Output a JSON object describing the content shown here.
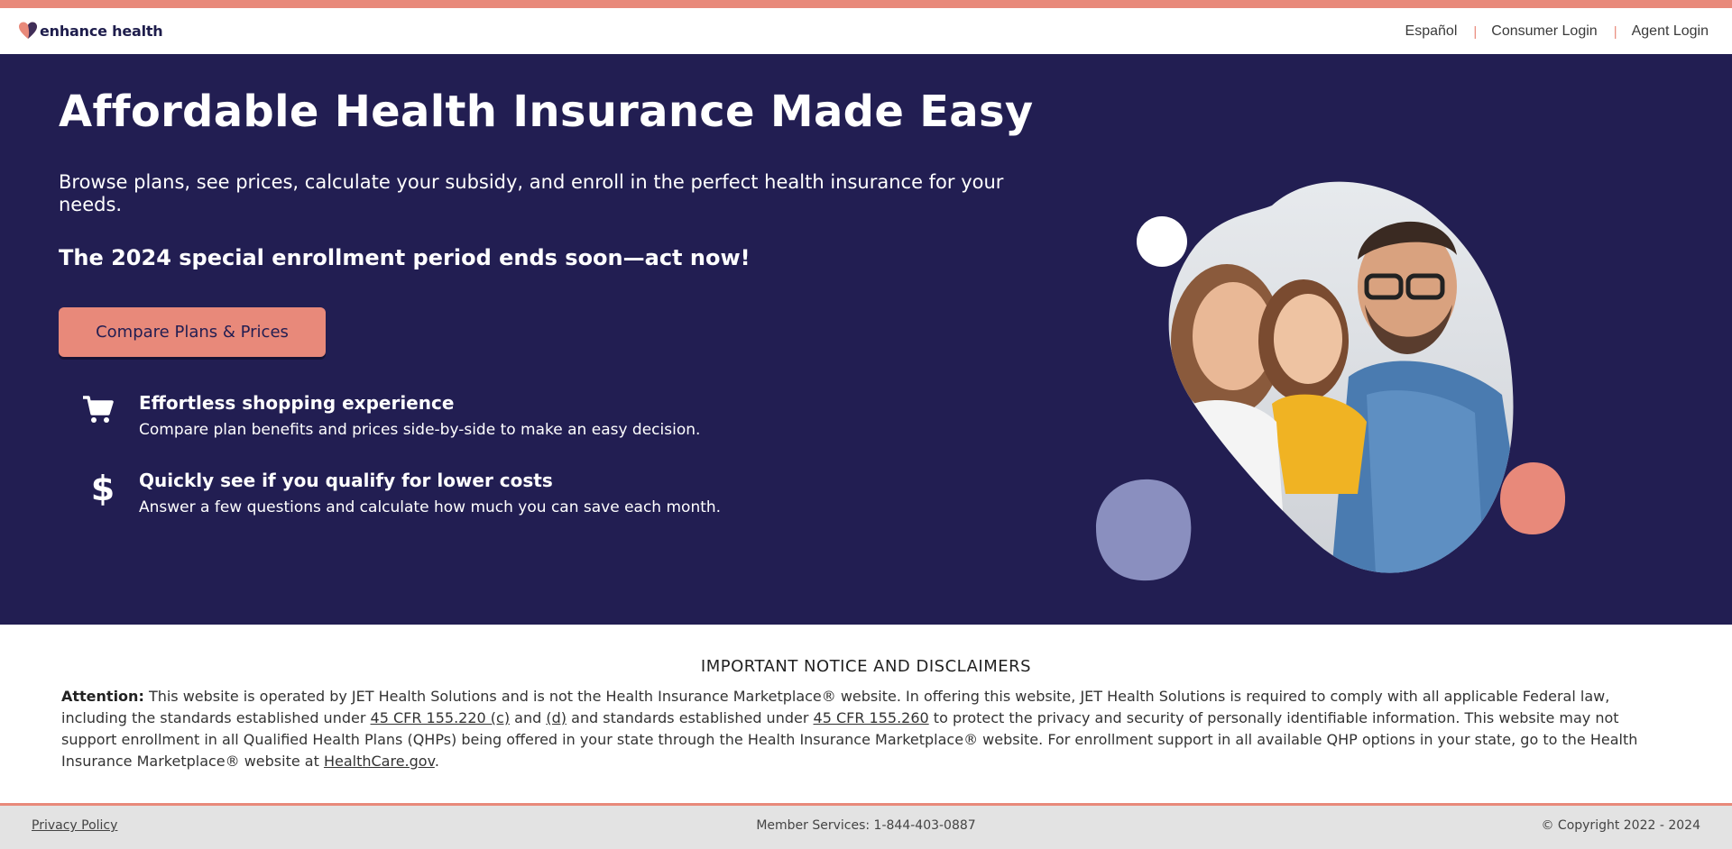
{
  "header": {
    "logo_text": "enhance health",
    "nav": {
      "espanol": "Español",
      "separator": "|",
      "consumer_login": "Consumer Login",
      "agent_login": "Agent Login"
    }
  },
  "hero": {
    "title": "Affordable Health Insurance Made Easy",
    "subtitle": "Browse plans, see prices, calculate your subsidy, and enroll in the perfect health insurance for your needs.",
    "enrollment_notice": "The 2024 special enrollment period ends soon—act now!",
    "cta_label": "Compare Plans & Prices",
    "features": [
      {
        "icon": "shopping-cart-icon",
        "title": "Effortless shopping experience",
        "description": "Compare plan benefits and prices side-by-side to make an easy decision."
      },
      {
        "icon": "dollar-sign-icon",
        "title": "Quickly see if you qualify for lower costs",
        "description": "Answer a few questions and calculate how much you can save each month."
      }
    ],
    "image": "family-photo"
  },
  "notice": {
    "heading": "IMPORTANT NOTICE AND DISCLAIMERS",
    "attention_label": "Attention:",
    "text_1": "This website is operated by JET Health Solutions and is not the Health Insurance Marketplace® website. In offering this website, JET Health Solutions is required to comply with all applicable Federal law, including the standards established under",
    "link_1": "45 CFR 155.220 (c)",
    "text_2": "and",
    "link_2": "(d)",
    "text_3": "and standards established under",
    "link_3": "45 CFR 155.260",
    "text_4": "to protect the privacy and security of personally identifiable information. This website may not support enrollment in all Qualified Health Plans (QHPs) being offered in your state through the Health Insurance Marketplace® website. For enrollment support in all available QHP options in your state, go to the Health Insurance Marketplace® website at",
    "link_4": "HealthCare.gov",
    "text_5": "."
  },
  "footer": {
    "privacy": "Privacy Policy",
    "member_services": "Member Services: 1-844-403-0887",
    "copyright": "© Copyright 2022 - 2024"
  },
  "colors": {
    "accent": "#E8897A",
    "navy": "#221e52",
    "lavender": "#8a8fbf"
  }
}
